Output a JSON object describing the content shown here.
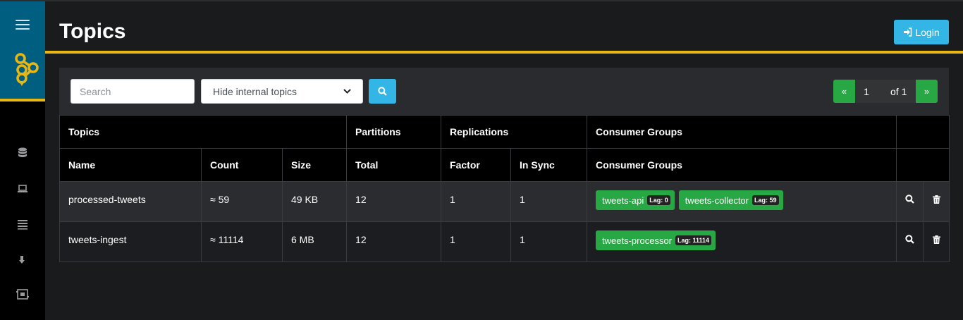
{
  "header": {
    "title": "Topics",
    "login_label": "Login"
  },
  "sidebar": {
    "items": [
      {
        "icon": "database-icon"
      },
      {
        "icon": "laptop-icon"
      },
      {
        "icon": "list-icon"
      },
      {
        "icon": "arrow-down-icon"
      },
      {
        "icon": "network-icon"
      }
    ]
  },
  "toolbar": {
    "search_placeholder": "Search",
    "filter_selected": "Hide internal topics"
  },
  "pagination": {
    "prev": "«",
    "current": "1",
    "of": "of 1",
    "next": "»"
  },
  "table": {
    "group_headers": [
      "Topics",
      "Partitions",
      "Replications",
      "Consumer Groups"
    ],
    "columns": [
      "Name",
      "Count",
      "Size",
      "Total",
      "Factor",
      "In Sync",
      "Consumer Groups"
    ],
    "rows": [
      {
        "name": "processed-tweets",
        "count": "≈ 59",
        "size": "49 KB",
        "total": "12",
        "factor": "1",
        "in_sync": "1",
        "groups": [
          {
            "name": "tweets-api",
            "lag": "Lag: 0"
          },
          {
            "name": "tweets-collector",
            "lag": "Lag: 59"
          }
        ]
      },
      {
        "name": "tweets-ingest",
        "count": "≈ 11114",
        "size": "6 MB",
        "total": "12",
        "factor": "1",
        "in_sync": "1",
        "groups": [
          {
            "name": "tweets-processor",
            "lag": "Lag: 11114"
          }
        ]
      }
    ]
  },
  "colors": {
    "accent": "#e8b714",
    "brand": "#005f81",
    "primary": "#33b5e5",
    "success": "#28a745"
  }
}
